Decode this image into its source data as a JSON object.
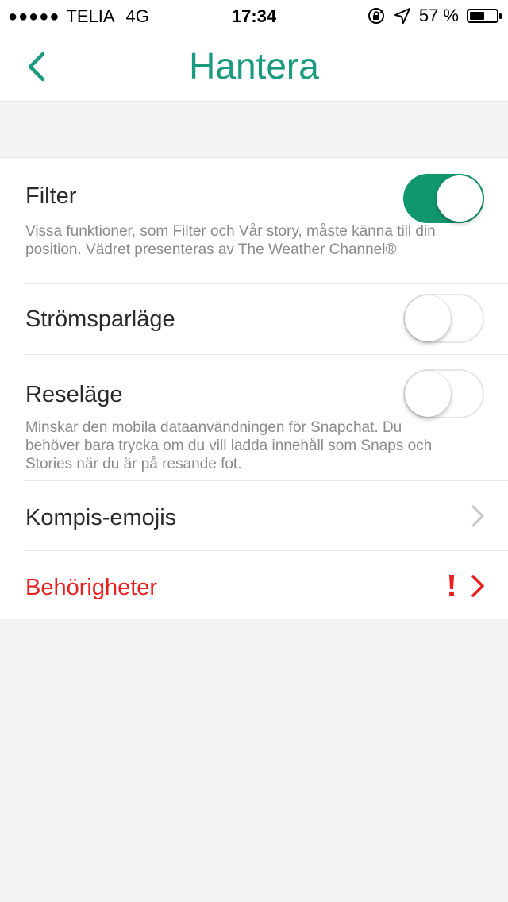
{
  "status_bar": {
    "signal_dots": "●●●●●",
    "carrier": "TELIA",
    "network": "4G",
    "time": "17:34",
    "battery_percent": "57 %",
    "battery_level": 0.57,
    "icons": [
      "rotation-lock-icon",
      "location-arrow-icon",
      "battery-icon"
    ]
  },
  "nav": {
    "title": "Hantera",
    "back_icon": "chevron-left-icon",
    "accent_color": "#1a9a7e"
  },
  "settings": {
    "filter": {
      "label": "Filter",
      "enabled": true,
      "description": "Vissa funktioner, som Filter och Vår story, måste känna till din position. Vädret presenteras av The Weather Channel®"
    },
    "power_saving": {
      "label": "Strömsparläge",
      "enabled": false
    },
    "travel_mode": {
      "label": "Reseläge",
      "enabled": false,
      "description": "Minskar den mobila dataanvändningen för Snapchat. Du behöver bara trycka om du vill ladda innehåll som Snaps och Stories när du är på resande fot."
    },
    "friend_emojis": {
      "label": "Kompis-emojis"
    },
    "permissions": {
      "label": "Behörigheter",
      "color": "#e8201e",
      "alert_icon": "exclamation-icon"
    }
  },
  "colors": {
    "toggle_on": "#11976f",
    "background": "#f3f3f3"
  }
}
